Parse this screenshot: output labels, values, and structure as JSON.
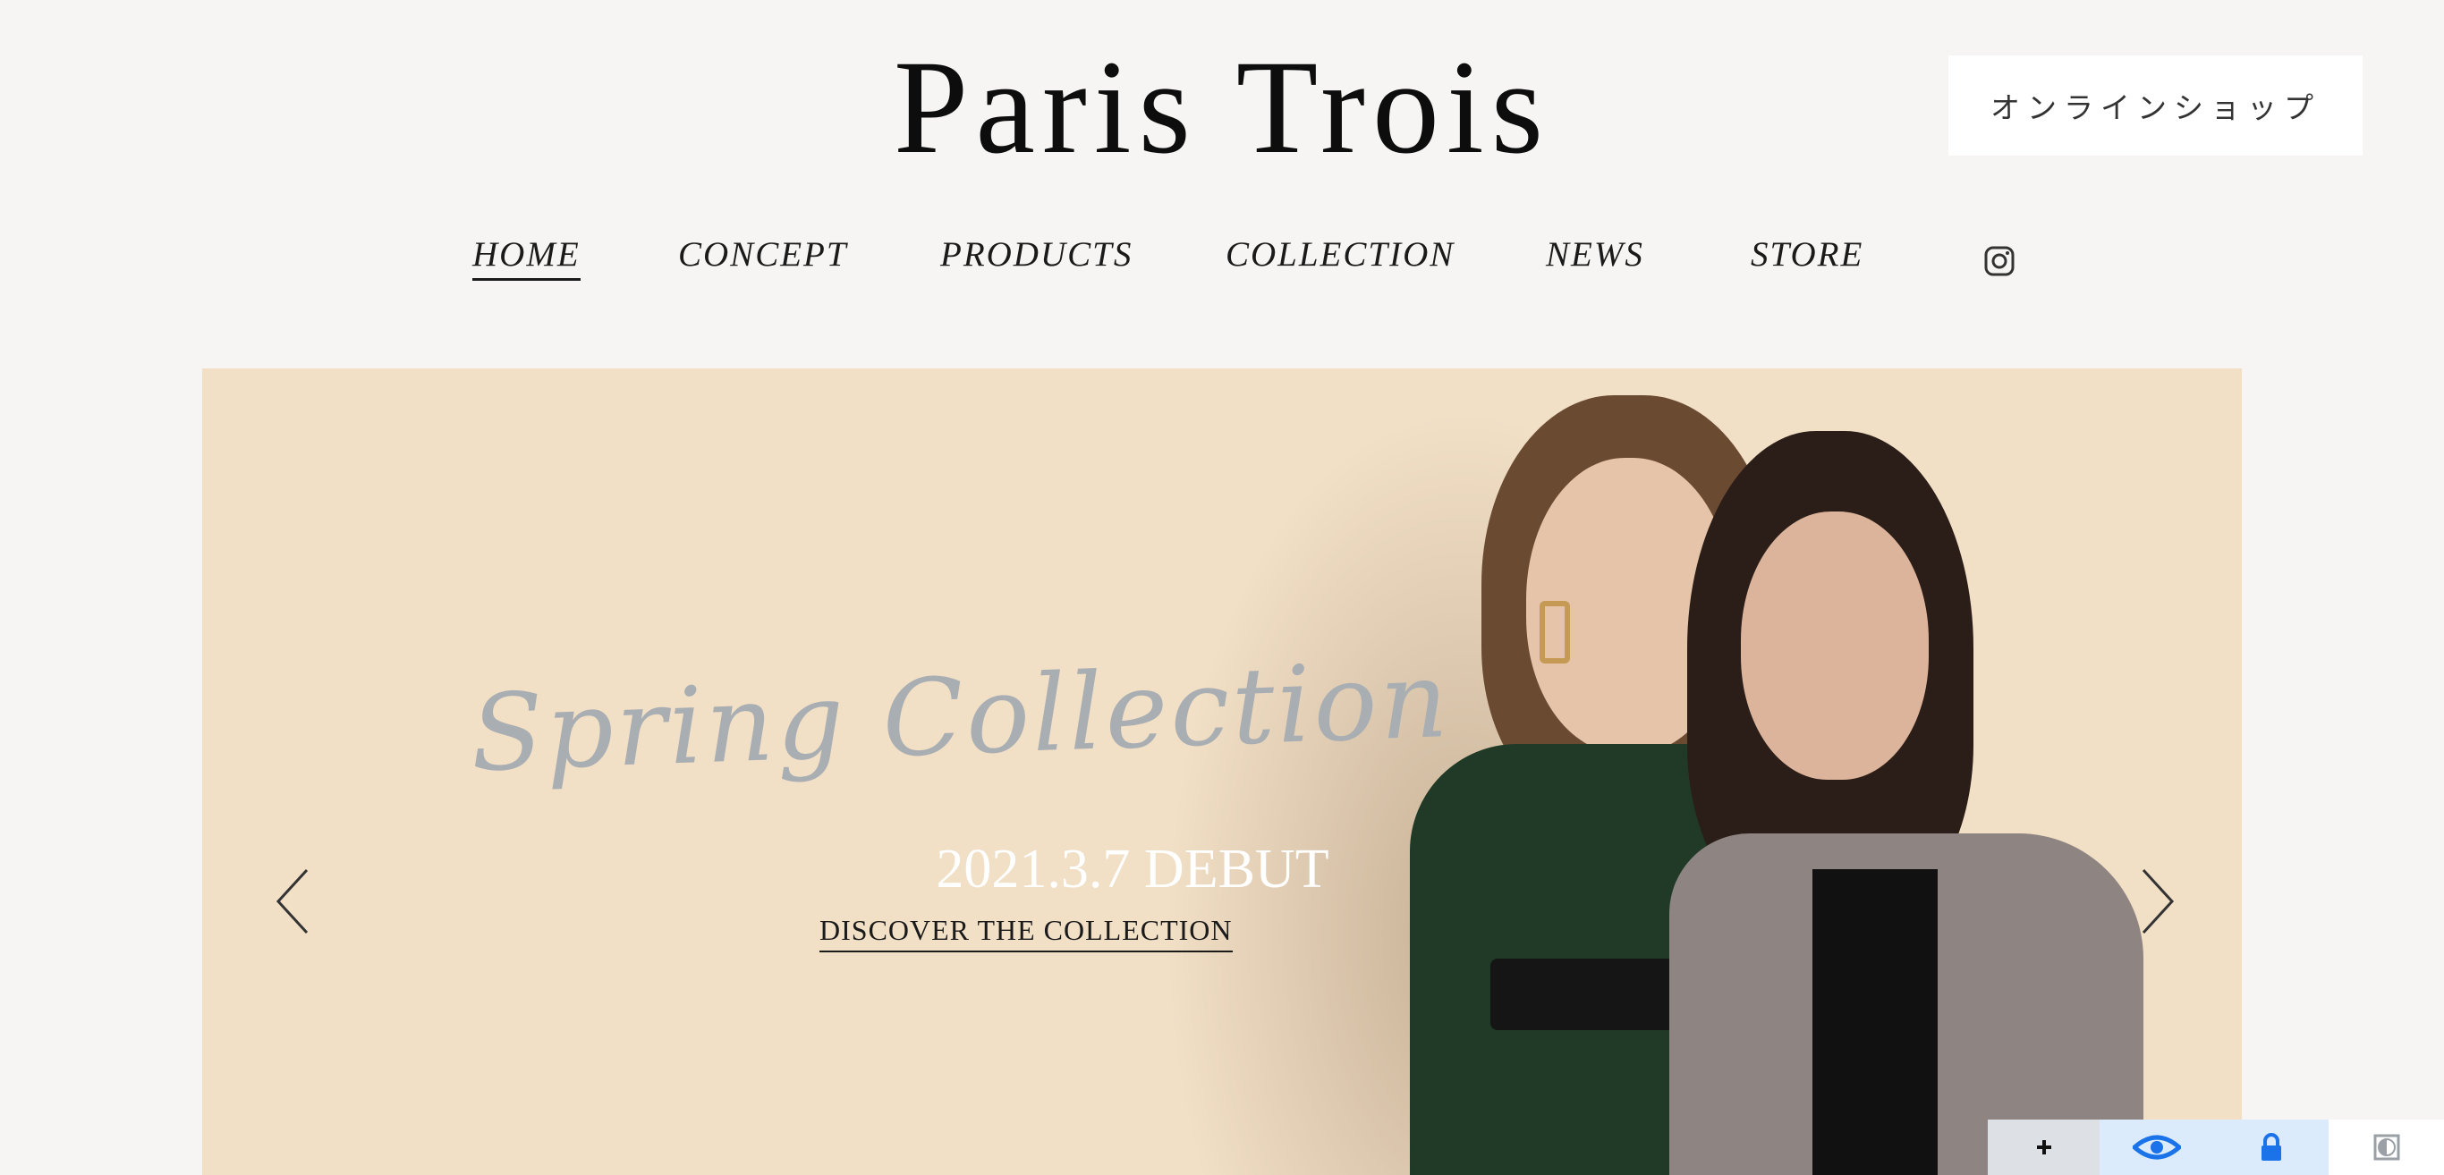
{
  "header": {
    "brand": "Paris Trois",
    "shop_button": "オンラインショップ"
  },
  "nav": {
    "items": [
      {
        "label": "HOME",
        "active": true
      },
      {
        "label": "CONCEPT",
        "active": false
      },
      {
        "label": "PRODUCTS",
        "active": false
      },
      {
        "label": "COLLECTION",
        "active": false
      },
      {
        "label": "NEWS",
        "active": false
      },
      {
        "label": "STORE",
        "active": false
      }
    ],
    "social_icon": "instagram-icon"
  },
  "hero": {
    "script_title": "Spring Collection",
    "debut": "2021.3.7 DEBUT",
    "cta": "DISCOVER THE COLLECTION",
    "prev_icon": "chevron-left-icon",
    "next_icon": "chevron-right-icon",
    "background_color": "#f1dfc6"
  },
  "accessibility_toolbar": {
    "buttons": [
      "plus-icon",
      "eye-icon",
      "lock-icon",
      "contrast-icon"
    ],
    "accent_color": "#1a73e8"
  }
}
